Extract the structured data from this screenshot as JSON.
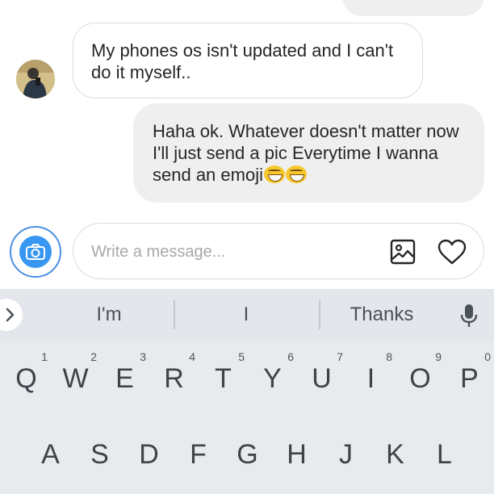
{
  "conversation": {
    "incoming_message": "My phones os isn't updated and I can't do it myself..",
    "outgoing_message": "Haha ok. Whatever doesn't matter now I'll just send a pic Everytime I wanna send an emoji",
    "outgoing_emoji": "grinning-squinting-face x2"
  },
  "composer": {
    "placeholder": "Write a message...",
    "value": "",
    "camera_icon": "camera-icon",
    "gallery_icon": "image-icon",
    "heart_icon": "heart-icon",
    "accent_color": "#3897f0"
  },
  "suggestions": {
    "expand_icon": "chevron-right-icon",
    "items": [
      "I'm",
      "I",
      "Thanks"
    ],
    "mic_icon": "microphone-icon"
  },
  "keyboard": {
    "row1": [
      {
        "key": "Q",
        "num": "1"
      },
      {
        "key": "W",
        "num": "2"
      },
      {
        "key": "E",
        "num": "3"
      },
      {
        "key": "R",
        "num": "4"
      },
      {
        "key": "T",
        "num": "5"
      },
      {
        "key": "Y",
        "num": "6"
      },
      {
        "key": "U",
        "num": "7"
      },
      {
        "key": "I",
        "num": "8"
      },
      {
        "key": "O",
        "num": "9"
      },
      {
        "key": "P",
        "num": "0"
      }
    ],
    "row2": [
      "A",
      "S",
      "D",
      "F",
      "G",
      "H",
      "J",
      "K",
      "L"
    ]
  }
}
